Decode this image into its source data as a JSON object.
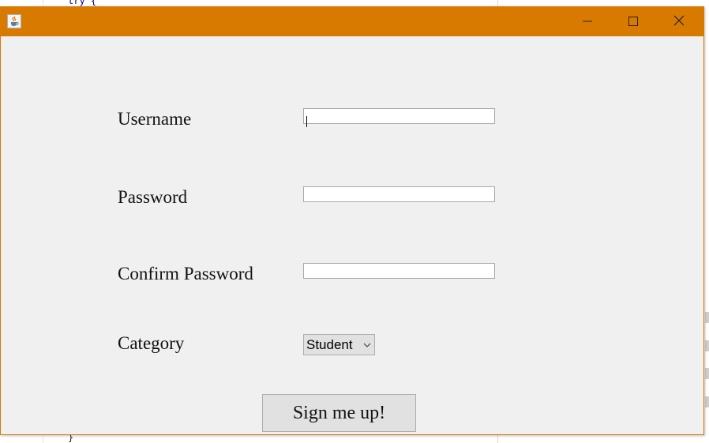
{
  "window": {
    "title": "",
    "titlebar_color": "#d97a00",
    "controls": {
      "minimize_icon": "minimize-icon",
      "maximize_icon": "maximize-icon",
      "close_icon": "close-icon"
    }
  },
  "background_editor": {
    "code_top": "try {",
    "code_bottom": "}"
  },
  "form": {
    "username": {
      "label": "Username",
      "value": ""
    },
    "password": {
      "label": "Password",
      "value": ""
    },
    "confirm_password": {
      "label": "Confirm Password",
      "value": ""
    },
    "category": {
      "label": "Category",
      "selected": "Student"
    },
    "submit_label": "Sign me up!"
  }
}
